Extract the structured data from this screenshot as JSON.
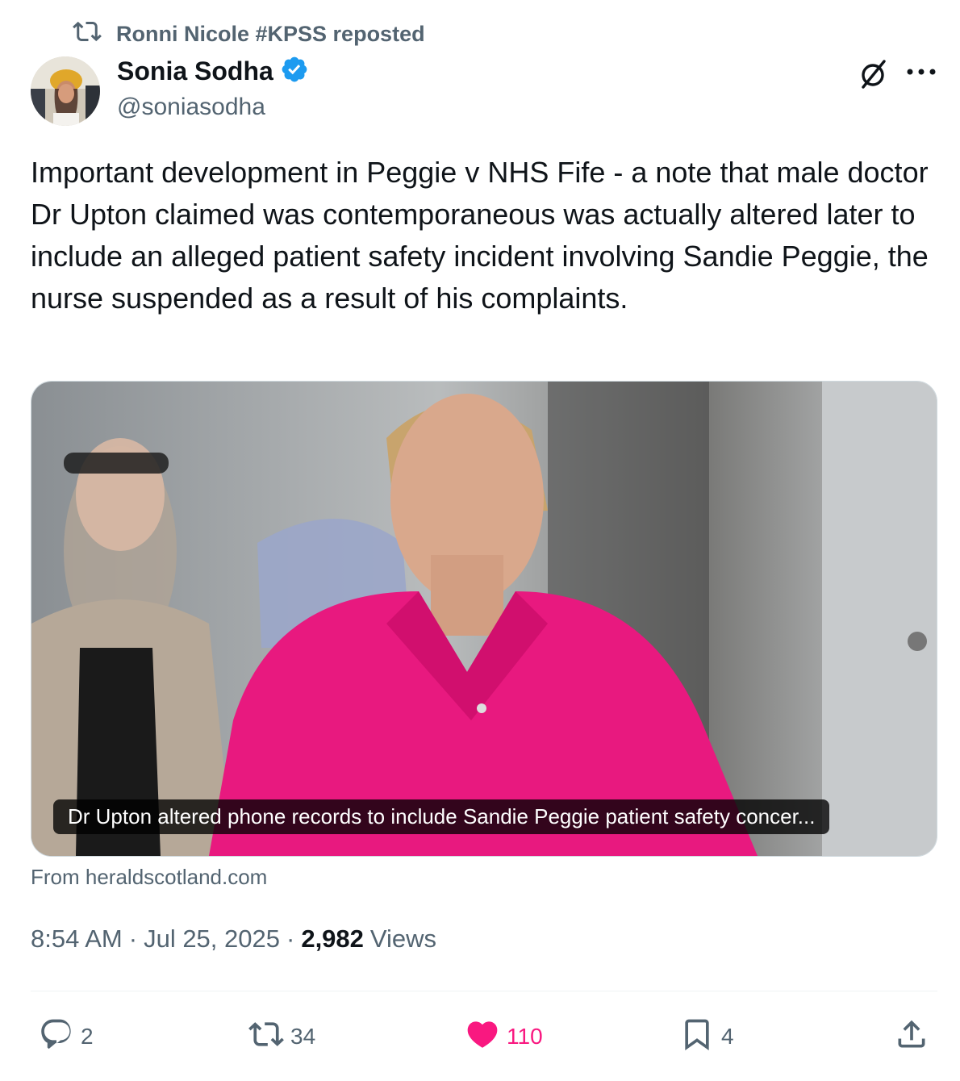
{
  "repost_header": {
    "text": "Ronni Nicole #KPSS reposted",
    "icon": "repost-icon"
  },
  "author": {
    "name": "Sonia Sodha",
    "handle": "@soniasodha",
    "verified": true,
    "verified_color": "#1d9bf0"
  },
  "tweet": {
    "text": "Important development in Peggie v NHS Fife - a note that male doctor Dr Upton claimed was contemporaneous was actually altered later to include an alleged patient safety incident involving Sandie Peggie, the nurse suspended as a result of his complaints."
  },
  "link_card": {
    "caption": "Dr Upton altered phone records to include Sandie Peggie patient safety concer...",
    "source": "From heraldscotland.com"
  },
  "meta": {
    "time": "8:54 AM",
    "date": "Jul 25, 2025",
    "views_count": "2,982",
    "views_label": "Views",
    "separator": "·"
  },
  "actions": {
    "replies": "2",
    "reposts": "34",
    "likes": "110",
    "bookmarks": "4",
    "like_color": "#f91880",
    "muted_color": "#536471"
  }
}
